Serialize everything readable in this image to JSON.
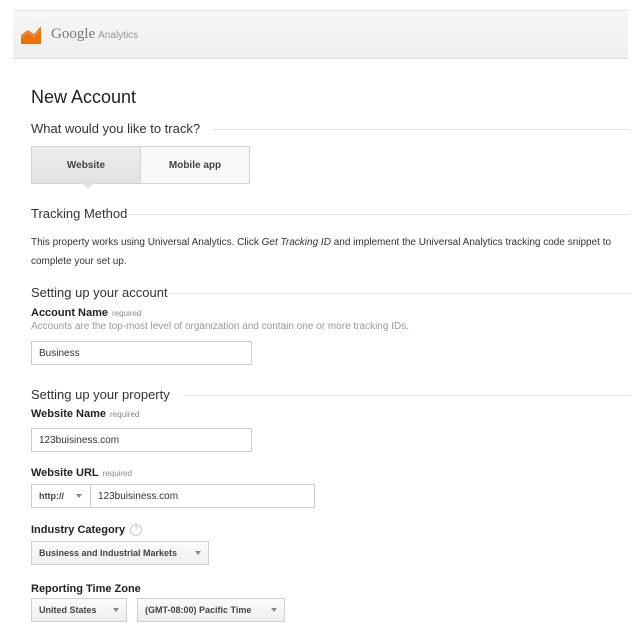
{
  "header": {
    "brand": "Google",
    "product": "Analytics"
  },
  "page_title": "New Account",
  "track": {
    "question": "What would you like to track?",
    "options": [
      {
        "label": "Website",
        "selected": true
      },
      {
        "label": "Mobile app",
        "selected": false
      }
    ]
  },
  "tracking_method": {
    "title": "Tracking Method",
    "text_before": "This property works using Universal Analytics. Click ",
    "text_emphasis": "Get Tracking ID",
    "text_after": " and implement the Universal Analytics tracking code snippet to complete your set up."
  },
  "account": {
    "section_title": "Setting up your account",
    "name_label": "Account Name",
    "required_label": "required",
    "help": "Accounts are the top-most level of organization and contain one or more tracking IDs.",
    "name_value": "Business"
  },
  "property": {
    "section_title": "Setting up your property",
    "website_name_label": "Website Name",
    "website_name_value": "123buisiness.com",
    "website_url_label": "Website URL",
    "url_protocol": "http://",
    "website_url_value": "123buisiness.com",
    "industry_label": "Industry Category",
    "help_glyph": "?",
    "industry_value": "Business and Industrial Markets",
    "timezone_label": "Reporting Time Zone",
    "timezone_country": "United States",
    "timezone_zone": "(GMT-08:00) Pacific Time"
  },
  "colors": {
    "logo_orange": "#f58220",
    "logo_dark_orange": "#e8710a"
  }
}
